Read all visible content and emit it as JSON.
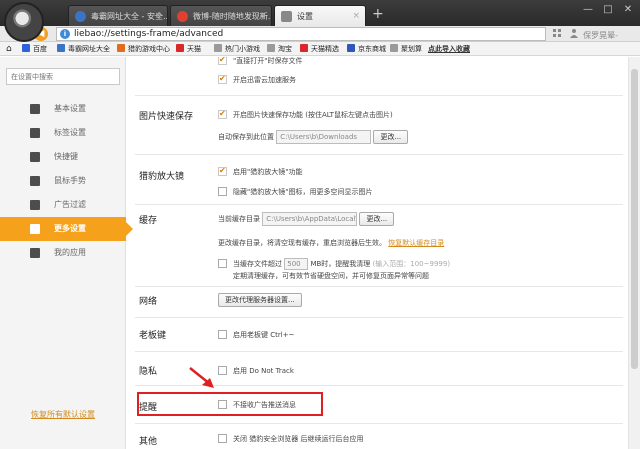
{
  "tabs": [
    {
      "title": "毒霸网址大全 - 安全...",
      "close": "×"
    },
    {
      "title": "微博-随时随地发现新...",
      "close": "×"
    },
    {
      "title": "设置",
      "close": "×"
    }
  ],
  "window": {
    "new_tab": "+",
    "minimize": "—",
    "maximize": "□",
    "close": "✕"
  },
  "address": {
    "url": "liebao://settings-frame/advanced",
    "tools_text": "保罗晃晕-"
  },
  "bookmarks": [
    "百度",
    "毒霸网址大全",
    "猎豹游戏中心",
    "天猫",
    "热门小游戏",
    "淘宝",
    "天猫精选",
    "京东商城",
    "聚划算",
    "点此导入收藏"
  ],
  "sidebar": {
    "search_placeholder": "在设置中搜索",
    "items": [
      "基本设置",
      "标签设置",
      "快捷键",
      "鼠标手势",
      "广告过滤",
      "更多设置",
      "我的应用"
    ],
    "active_index": 5,
    "reset_link": "恢复所有默认设置"
  },
  "content": {
    "top_rows": [
      "\"直接打开\"时保存文件",
      "开启迅雷云加速服务"
    ],
    "image_save": {
      "title": "图片快速保存",
      "option": "开启图片快速保存功能 (按住ALT鼠标左键点击图片)",
      "location_label": "自动保存到此位置",
      "location_value": "C:\\Users\\b\\Downloads",
      "change_btn": "更改..."
    },
    "magnifier": {
      "title": "猎豹放大镜",
      "opt1": "启用\"猎豹放大镜\"功能",
      "opt2": "隐藏\"猎豹放大镜\"图标，用更多空间显示图片"
    },
    "cache": {
      "title": "缓存",
      "dir_label": "当前缓存目录",
      "dir_value": "C:\\Users\\b\\AppData\\Local\\lie",
      "change_btn": "更改...",
      "note": "更改缓存目录，将清空现有缓存，重启浏览器后生效。",
      "restore_link": "恢复默认缓存目录",
      "limit_pre": "当缓存文件超过",
      "limit_value": "500",
      "limit_post": "MB时，提醒我清理",
      "limit_hint": "(输入范围：100~9999)",
      "limit_note": "定期清理缓存，可有效节省硬盘空间，并可修复页面异常等问题"
    },
    "network": {
      "title": "网络",
      "btn": "更改代理服务器设置..."
    },
    "boss_key": {
      "title": "老板键",
      "option": "启用老板键",
      "shortcut": "Ctrl+~"
    },
    "privacy": {
      "title": "隐私",
      "option": "启用 Do Not Track"
    },
    "remind": {
      "title": "提醒",
      "option": "不接收广告推送消息"
    },
    "other": {
      "title": "其他",
      "option": "关闭 猎豹安全浏览器 后继续运行后台应用"
    }
  },
  "colors": {
    "accent": "#f5a11c",
    "highlight_border": "#e02020",
    "link": "#d48a1a"
  }
}
